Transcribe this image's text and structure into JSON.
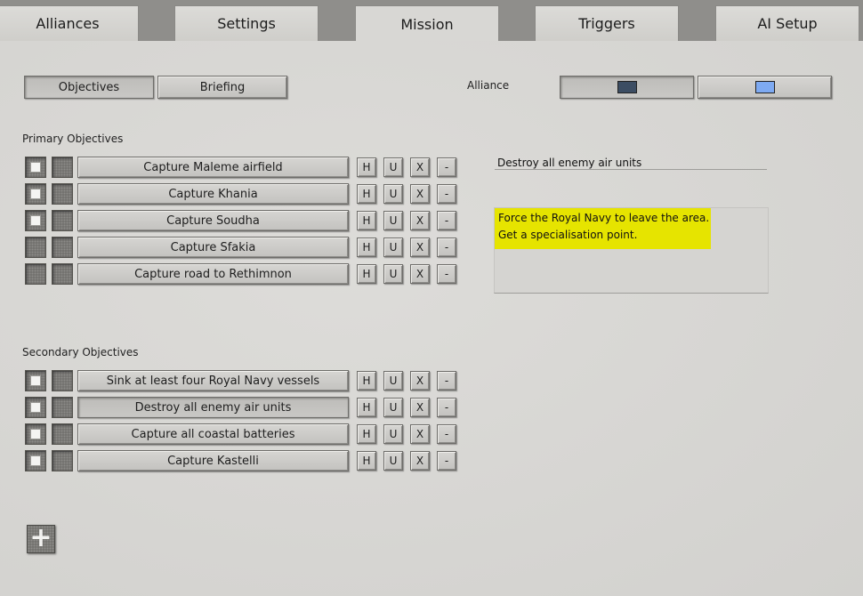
{
  "tabs": [
    {
      "label": "Alliances"
    },
    {
      "label": "Settings"
    },
    {
      "label": "Mission"
    },
    {
      "label": "Triggers"
    },
    {
      "label": "AI Setup"
    }
  ],
  "active_tab": "Mission",
  "subtabs": {
    "objectives": "Objectives",
    "briefing": "Briefing"
  },
  "alliance": {
    "label": "Alliance",
    "colors": [
      "#3c4d63",
      "#7eaaf2"
    ]
  },
  "primary": {
    "title": "Primary Objectives",
    "items": [
      {
        "label": "Capture Maleme airfield",
        "checked": true
      },
      {
        "label": "Capture Khania",
        "checked": true
      },
      {
        "label": "Capture Soudha",
        "checked": true
      },
      {
        "label": "Capture Sfakia",
        "checked": false
      },
      {
        "label": "Capture road to Rethimnon",
        "checked": false
      }
    ]
  },
  "secondary": {
    "title": "Secondary Objectives",
    "items": [
      {
        "label": "Sink at least four Royal Navy vessels",
        "checked": true
      },
      {
        "label": "Destroy all enemy air units",
        "checked": true
      },
      {
        "label": "Capture all coastal batteries",
        "checked": true
      },
      {
        "label": "Capture Kastelli",
        "checked": true
      }
    ]
  },
  "row_buttons": [
    "H",
    "U",
    "X",
    "-"
  ],
  "selected_objective": "Destroy all enemy air units",
  "description": {
    "lines": [
      "Force the Royal Navy to leave the area.",
      "Get a specialisation point."
    ]
  },
  "add_button": "+"
}
